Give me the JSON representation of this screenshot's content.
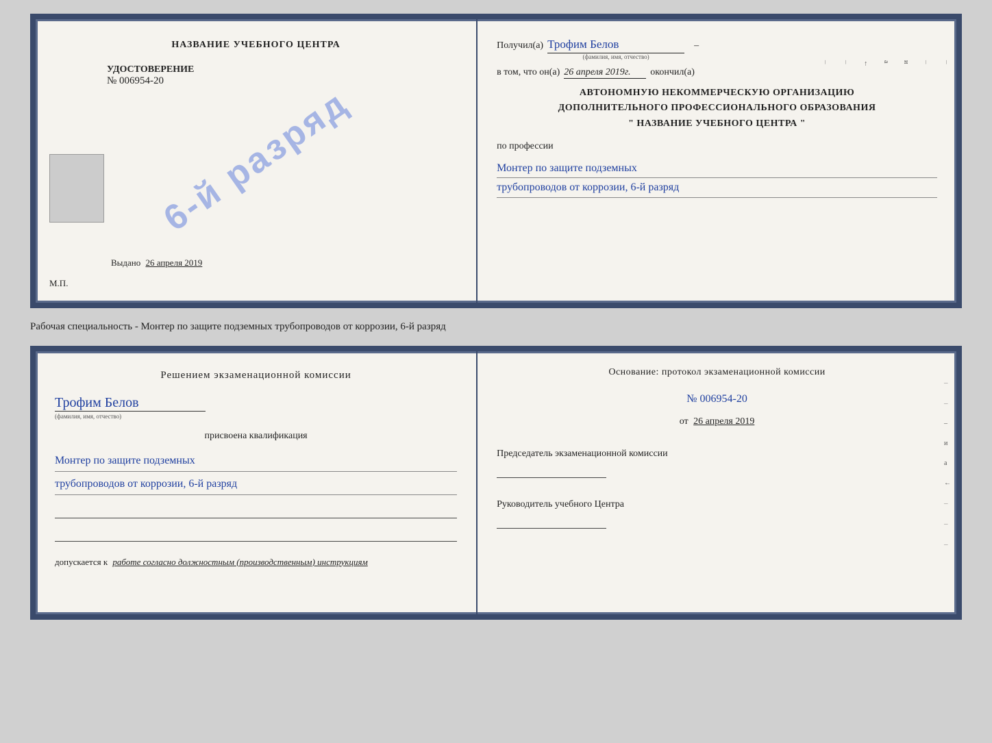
{
  "top_cert": {
    "left": {
      "school_title": "НАЗВАНИЕ УЧЕБНОГО ЦЕНТРА",
      "stamp_text": "6-й разряд",
      "udostoverenie_label": "УДОСТОВЕРЕНИЕ",
      "cert_number": "№ 006954-20",
      "issued_label": "Выдано",
      "issued_date": "26 апреля 2019",
      "mp_label": "М.П."
    },
    "right": {
      "recipient_prefix": "Получил(а)",
      "recipient_name": "Трофим Белов",
      "fio_hint": "(фамилия, имя, отчество)",
      "date_prefix": "в том, что он(а)",
      "date_value": "26 апреля 2019г.",
      "date_suffix": "окончил(а)",
      "org_line1": "АВТОНОМНУЮ НЕКОММЕРЧЕСКУЮ ОРГАНИЗАЦИЮ",
      "org_line2": "ДОПОЛНИТЕЛЬНОГО ПРОФЕССИОНАЛЬНОГО ОБРАЗОВАНИЯ",
      "org_line3": "\"  НАЗВАНИЕ УЧЕБНОГО ЦЕНТРА  \"",
      "profession_label": "по профессии",
      "profession_line1": "Монтер по защите подземных",
      "profession_line2": "трубопроводов от коррозии, 6-й разряд"
    }
  },
  "middle": {
    "text": "Рабочая специальность - Монтер по защите подземных трубопроводов от коррозии, 6-й разряд"
  },
  "bottom_cert": {
    "left": {
      "decision_title": "Решением экзаменационной комиссии",
      "name_cursive": "Трофим Белов",
      "fio_hint": "(фамилия, имя, отчество)",
      "assigned_label": "присвоена квалификация",
      "profession_line1": "Монтер по защите подземных",
      "profession_line2": "трубопроводов от коррозии, 6-й разряд",
      "допускается_label": "допускается к",
      "допускается_val": "работе согласно должностным (производственным) инструкциям"
    },
    "right": {
      "basis_title": "Основание: протокол экзаменационной комиссии",
      "basis_number": "№ 006954-20",
      "date_prefix": "от",
      "date_value": "26 апреля 2019",
      "chairman_label": "Председатель экзаменационной комиссии",
      "head_label": "Руководитель учебного Центра"
    }
  }
}
